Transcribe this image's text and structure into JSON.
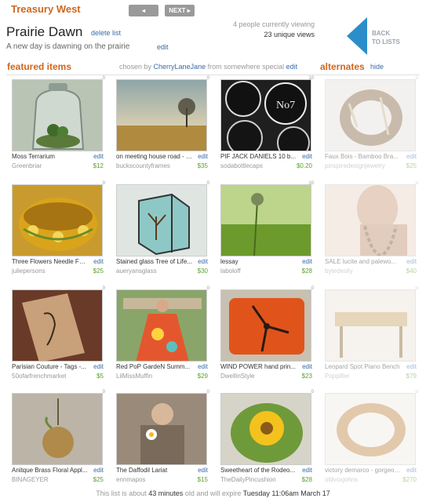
{
  "header": {
    "brand": "Treasury West",
    "prev_label": "◂ PREV",
    "next_label": "NEXT ▸",
    "list_title": "Prairie Dawn",
    "delete_label": "delete list",
    "subtitle": "A new day is dawning on the prairie",
    "edit_label": "edit",
    "viewing": "4 people currently viewing",
    "unique": "23 unique views",
    "back_label": "BACK TO LISTS"
  },
  "section": {
    "featured_label": "featured items",
    "chosen_by_prefix": "chosen by",
    "curator": "CherryLaneJane",
    "chosen_from": "from  somewhere special",
    "chosen_edit": "edit",
    "alternates_label": "alternates",
    "hide_label": "hide"
  },
  "items": [
    {
      "rank": "0",
      "title": "Moss Terrarium",
      "shop": "Greenbriar",
      "price": "$12",
      "edit": "edit",
      "img": "terrarium",
      "alt": false
    },
    {
      "rank": "0",
      "title": "on meeting house road - c...",
      "shop": "buckscountyframes",
      "price": "$35",
      "edit": "edit",
      "img": "landscape",
      "alt": false
    },
    {
      "rank": "10",
      "title": "PIF JACK DANIELS 10 b...",
      "shop": "sodabottlecaps",
      "price": "$0.20",
      "edit": "edit",
      "img": "bottlecaps",
      "alt": false
    },
    {
      "rank": "0",
      "title": "Faux Bois - Bamboo Bra...",
      "shop": "pinspiredesignjewelry",
      "price": "$25",
      "edit": "edit",
      "img": "bangle",
      "alt": true
    },
    {
      "rank": "0",
      "title": "Three Flowers Needle Fel...",
      "shop": "juliepersons",
      "price": "$25",
      "edit": "edit",
      "img": "feltbowl",
      "alt": false
    },
    {
      "rank": "0",
      "title": "Stained glass Tree of Life...",
      "shop": "aueryansglass",
      "price": "$30",
      "edit": "edit",
      "img": "stainedglass",
      "alt": false
    },
    {
      "rank": "10",
      "title": "lessay",
      "shop": "laboloff",
      "price": "$28",
      "edit": "edit",
      "img": "field",
      "alt": false
    },
    {
      "rank": "0",
      "title": "SALE lucite and palewo...",
      "shop": "bytedesily",
      "price": "$40",
      "edit": "edit",
      "img": "necklace",
      "alt": true
    },
    {
      "rank": "0",
      "title": "Parisian Couture - Tags -...",
      "shop": "50ofarfrenchmarket",
      "price": "$5",
      "edit": "edit",
      "img": "tags",
      "alt": false
    },
    {
      "rank": "0",
      "title": "Red PoP GardeN Summ...",
      "shop": "LilMissMuffin",
      "price": "$29",
      "edit": "edit",
      "img": "dress",
      "alt": false
    },
    {
      "rank": "0",
      "title": "WIND POWER hand prin...",
      "shop": "DwellinStyle",
      "price": "$23",
      "edit": "edit",
      "img": "pillow",
      "alt": false
    },
    {
      "rank": "0",
      "title": "Leopard Spot Piano Bench",
      "shop": "Poppifier",
      "price": "$79",
      "edit": "edit",
      "img": "bench",
      "alt": true
    },
    {
      "rank": "0",
      "title": "Anitque Brass Floral Appl...",
      "shop": "BINAGEYER",
      "price": "$25",
      "edit": "edit",
      "img": "pendant",
      "alt": false
    },
    {
      "rank": "0",
      "title": "The Daffodil Lariat",
      "shop": "ennmapos",
      "price": "$15",
      "edit": "edit",
      "img": "lariat",
      "alt": false
    },
    {
      "rank": "0",
      "title": "Sweetheart of the Rodeo...",
      "shop": "TheDailyPincushion",
      "price": "$28",
      "edit": "edit",
      "img": "pincushion",
      "alt": false
    },
    {
      "rank": "0",
      "title": "victory demarco - gorgeous...",
      "shop": "oldvoxjohns",
      "price": "$270",
      "edit": "edit",
      "img": "ring",
      "alt": true
    }
  ],
  "footer": {
    "prefix": "This list is about",
    "age": "43 minutes",
    "middle": "old and will expire",
    "expires": "Tuesday 11:06am  March 17"
  }
}
